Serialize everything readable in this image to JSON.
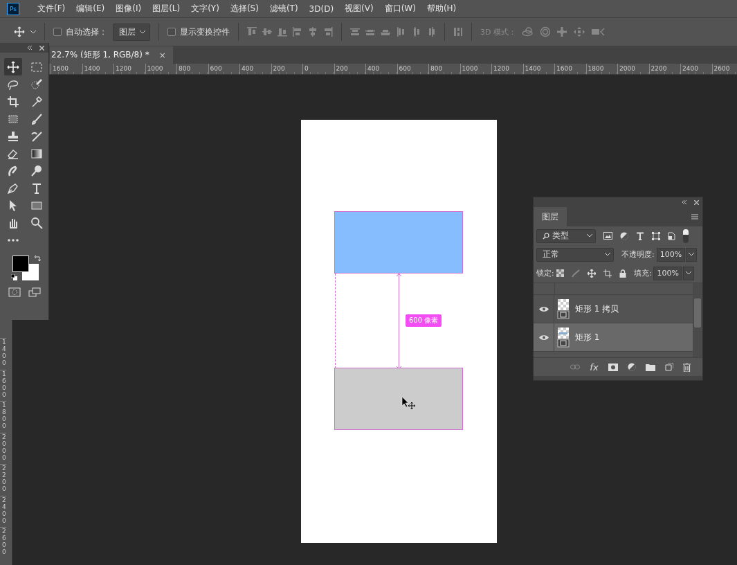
{
  "app_logo": "Ps",
  "menu": [
    "文件(F)",
    "编辑(E)",
    "图像(I)",
    "图层(L)",
    "文字(Y)",
    "选择(S)",
    "滤镜(T)",
    "3D(D)",
    "视图(V)",
    "窗口(W)",
    "帮助(H)"
  ],
  "options_bar": {
    "auto_select": {
      "label": "自动选择：",
      "checked": false
    },
    "target": {
      "value": "图层"
    },
    "show_transform": {
      "label": "显示变换控件",
      "checked": false
    },
    "mode_3d_label": "3D 模式："
  },
  "document_tab": {
    "title": "22.7% (矩形 1, RGB/8) *",
    "close": "×"
  },
  "horizontal_ruler": [
    "1600",
    "1400",
    "1200",
    "1000",
    "800",
    "600",
    "400",
    "200",
    "0",
    "200",
    "400",
    "600",
    "800",
    "1000",
    "1200",
    "1400",
    "1600",
    "1800",
    "2000",
    "2200",
    "2400",
    "2600"
  ],
  "vertical_ruler": [
    "1400",
    "1600",
    "1800",
    "2000",
    "2200",
    "2400",
    "2600"
  ],
  "tools": [
    {
      "kind": "move",
      "selected": true
    },
    {
      "kind": "marquee",
      "selected": false
    },
    {
      "kind": "lasso",
      "selected": false
    },
    {
      "kind": "quick-select",
      "selected": false
    },
    {
      "kind": "crop",
      "selected": false
    },
    {
      "kind": "eyedropper",
      "selected": false
    },
    {
      "kind": "patch",
      "selected": false
    },
    {
      "kind": "brush",
      "selected": false
    },
    {
      "kind": "stamp",
      "selected": false
    },
    {
      "kind": "history-brush",
      "selected": false
    },
    {
      "kind": "eraser",
      "selected": false
    },
    {
      "kind": "gradient",
      "selected": false
    },
    {
      "kind": "smudge",
      "selected": false
    },
    {
      "kind": "dodge",
      "selected": false
    },
    {
      "kind": "pen",
      "selected": false
    },
    {
      "kind": "type",
      "selected": false
    },
    {
      "kind": "path-select",
      "selected": false
    },
    {
      "kind": "rectangle",
      "selected": false
    },
    {
      "kind": "hand",
      "selected": false
    },
    {
      "kind": "zoom",
      "selected": false
    },
    {
      "kind": "more",
      "selected": false
    }
  ],
  "canvas": {
    "measure_label": "600 像素"
  },
  "layers_panel": {
    "tab": "图层",
    "filter": "类型",
    "blend_mode": "正常",
    "opacity_label": "不透明度:",
    "opacity": "100%",
    "lock_label": "锁定:",
    "fill_label": "填充:",
    "fill": "100%",
    "fx": "fx",
    "layers": [
      {
        "name": "矩形 1 拷贝",
        "visible": true,
        "selected": false
      },
      {
        "name": "矩形 1",
        "visible": true,
        "selected": true
      }
    ]
  }
}
